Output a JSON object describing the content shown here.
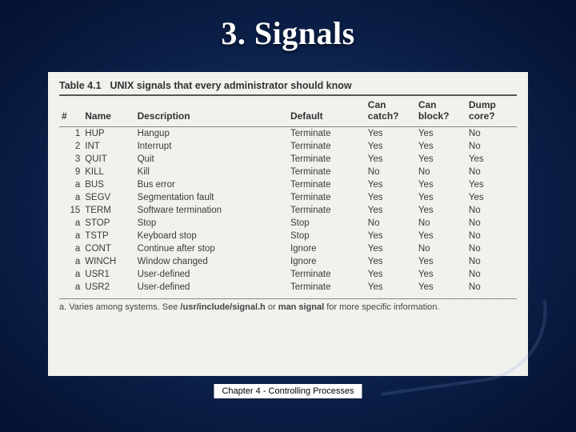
{
  "slide": {
    "title": "3. Signals",
    "footer": "Chapter 4 - Controlling Processes"
  },
  "table": {
    "label_number": "Table 4.1",
    "caption": "UNIX signals that every administrator should know",
    "headers": {
      "num": "#",
      "name": "Name",
      "desc": "Description",
      "def": "Default",
      "catch": "Can catch?",
      "block": "Can block?",
      "core": "Dump core?"
    },
    "rows": [
      {
        "num": "1",
        "name": "HUP",
        "desc": "Hangup",
        "def": "Terminate",
        "catch": "Yes",
        "block": "Yes",
        "core": "No"
      },
      {
        "num": "2",
        "name": "INT",
        "desc": "Interrupt",
        "def": "Terminate",
        "catch": "Yes",
        "block": "Yes",
        "core": "No"
      },
      {
        "num": "3",
        "name": "QUIT",
        "desc": "Quit",
        "def": "Terminate",
        "catch": "Yes",
        "block": "Yes",
        "core": "Yes"
      },
      {
        "num": "9",
        "name": "KILL",
        "desc": "Kill",
        "def": "Terminate",
        "catch": "No",
        "block": "No",
        "core": "No"
      },
      {
        "num": "a",
        "name": "BUS",
        "desc": "Bus error",
        "def": "Terminate",
        "catch": "Yes",
        "block": "Yes",
        "core": "Yes"
      },
      {
        "num": "a",
        "name": "SEGV",
        "desc": "Segmentation fault",
        "def": "Terminate",
        "catch": "Yes",
        "block": "Yes",
        "core": "Yes"
      },
      {
        "num": "15",
        "name": "TERM",
        "desc": "Software termination",
        "def": "Terminate",
        "catch": "Yes",
        "block": "Yes",
        "core": "No"
      },
      {
        "num": "a",
        "name": "STOP",
        "desc": "Stop",
        "def": "Stop",
        "catch": "No",
        "block": "No",
        "core": "No"
      },
      {
        "num": "a",
        "name": "TSTP",
        "desc": "Keyboard stop",
        "def": "Stop",
        "catch": "Yes",
        "block": "Yes",
        "core": "No"
      },
      {
        "num": "a",
        "name": "CONT",
        "desc": "Continue after stop",
        "def": "Ignore",
        "catch": "Yes",
        "block": "No",
        "core": "No"
      },
      {
        "num": "a",
        "name": "WINCH",
        "desc": "Window changed",
        "def": "Ignore",
        "catch": "Yes",
        "block": "Yes",
        "core": "No"
      },
      {
        "num": "a",
        "name": "USR1",
        "desc": "User-defined",
        "def": "Terminate",
        "catch": "Yes",
        "block": "Yes",
        "core": "No"
      },
      {
        "num": "a",
        "name": "USR2",
        "desc": "User-defined",
        "def": "Terminate",
        "catch": "Yes",
        "block": "Yes",
        "core": "No"
      }
    ],
    "footnote_prefix": "a. Varies among systems. See ",
    "footnote_path": "/usr/include/signal.h",
    "footnote_mid": " or ",
    "footnote_man": "man signal",
    "footnote_suffix": " for more specific information."
  }
}
